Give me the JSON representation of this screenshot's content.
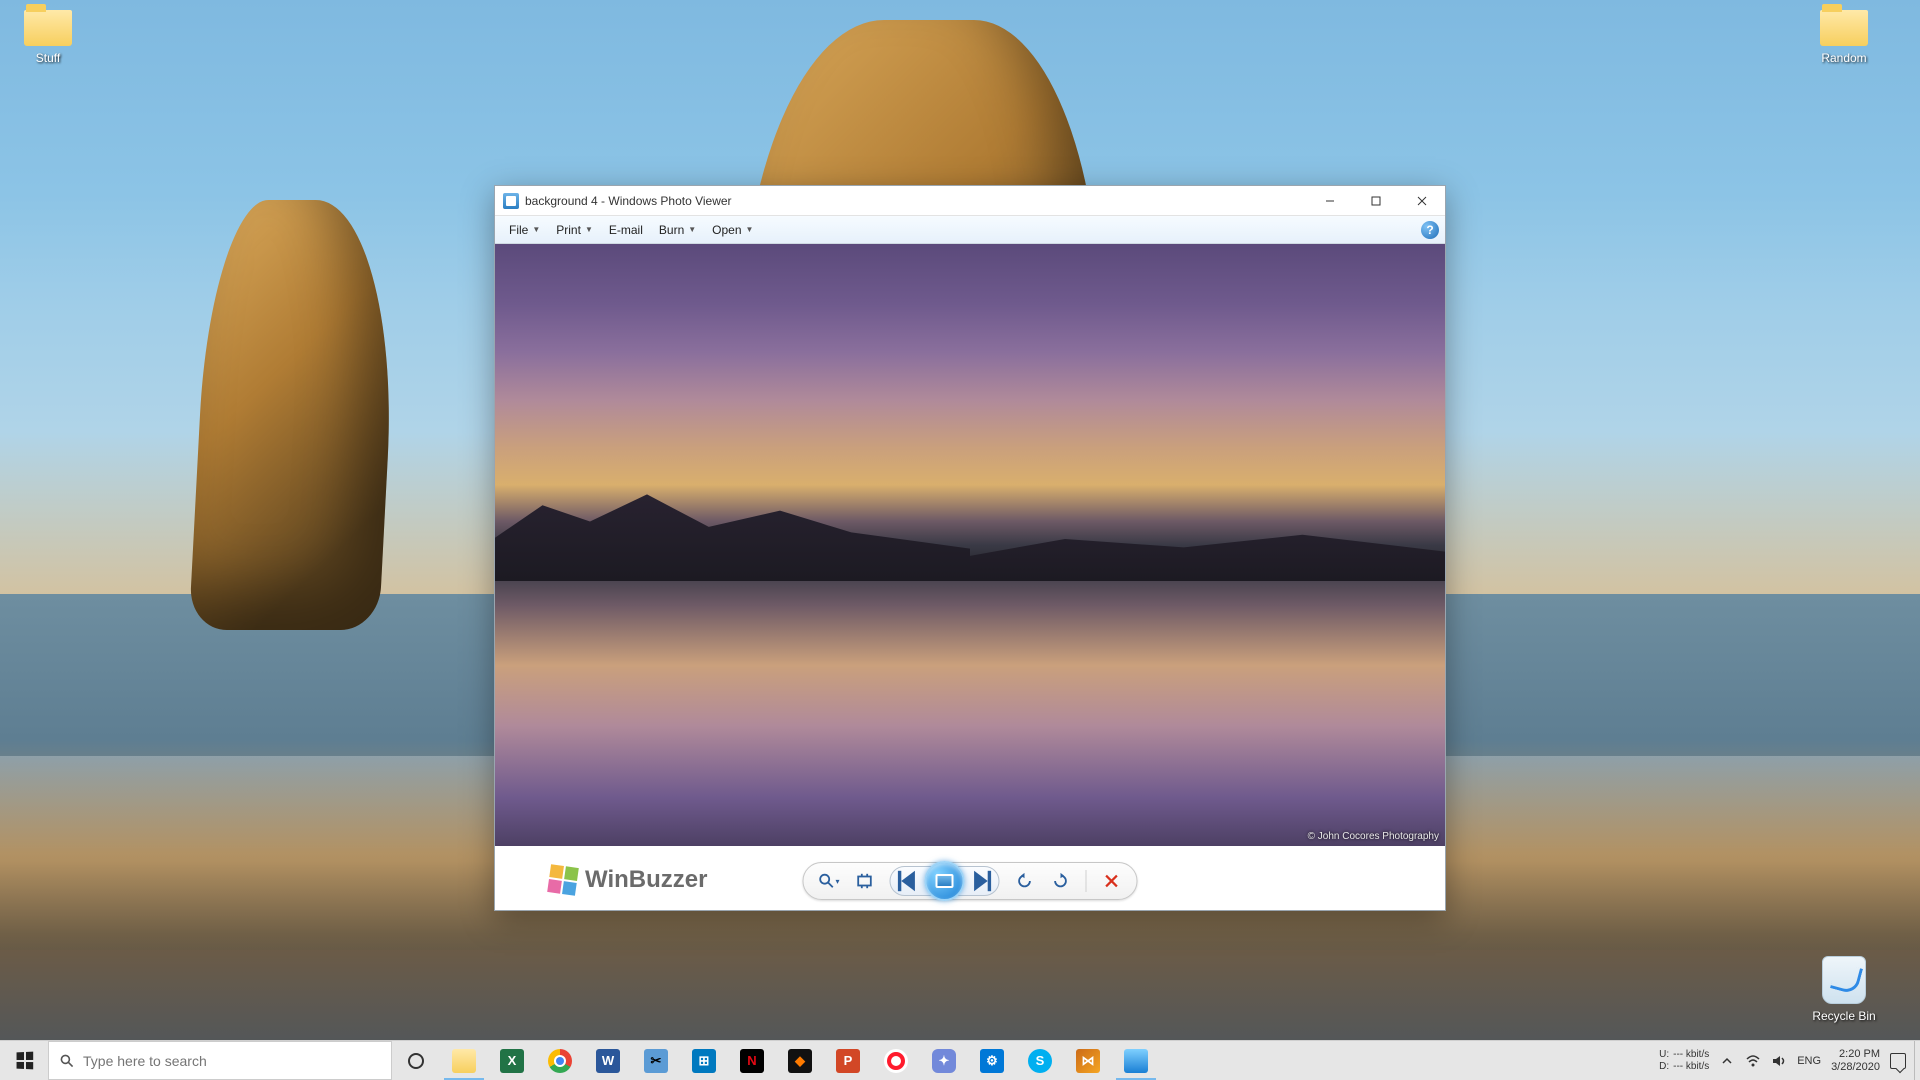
{
  "desktop": {
    "icons": {
      "stuff": {
        "label": "Stuff"
      },
      "random": {
        "label": "Random"
      },
      "recycle": {
        "label": "Recycle Bin"
      }
    }
  },
  "window": {
    "title": "background 4 - Windows Photo Viewer",
    "menu": {
      "file": "File",
      "print": "Print",
      "email": "E-mail",
      "burn": "Burn",
      "open": "Open"
    },
    "help_tooltip": "?",
    "image_credit": "© John Cocores Photography",
    "watermark": "WinBuzzer"
  },
  "taskbar": {
    "search_placeholder": "Type here to search",
    "net": {
      "u_label": "U:",
      "d_label": "D:",
      "u_value": "--- kbit/s",
      "d_value": "--- kbit/s"
    },
    "lang": "ENG",
    "time": "2:20 PM",
    "date": "3/28/2020"
  }
}
